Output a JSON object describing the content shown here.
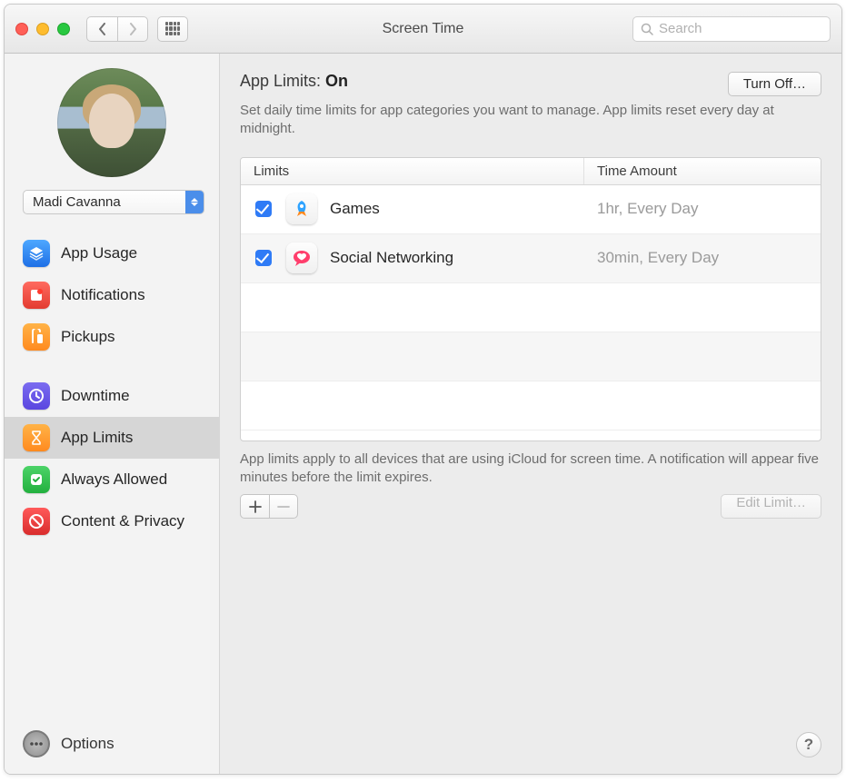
{
  "window": {
    "title": "Screen Time",
    "search_placeholder": "Search"
  },
  "sidebar": {
    "user_name": "Madi Cavanna",
    "groups": [
      [
        {
          "id": "app-usage",
          "label": "App Usage",
          "icon": "layers-icon"
        },
        {
          "id": "notifications",
          "label": "Notifications",
          "icon": "bell-square-icon"
        },
        {
          "id": "pickups",
          "label": "Pickups",
          "icon": "pickup-icon"
        }
      ],
      [
        {
          "id": "downtime",
          "label": "Downtime",
          "icon": "clock-moon-icon"
        },
        {
          "id": "app-limits",
          "label": "App Limits",
          "icon": "hourglass-icon",
          "selected": true
        },
        {
          "id": "always-allowed",
          "label": "Always Allowed",
          "icon": "check-shield-icon"
        },
        {
          "id": "content-privacy",
          "label": "Content & Privacy",
          "icon": "no-entry-icon"
        }
      ]
    ],
    "options_label": "Options"
  },
  "main": {
    "title_prefix": "App Limits: ",
    "status": "On",
    "turn_off_label": "Turn Off…",
    "description": "Set daily time limits for app categories you want to manage. App limits reset every day at midnight.",
    "columns": {
      "limits": "Limits",
      "time": "Time Amount"
    },
    "rows": [
      {
        "enabled": true,
        "icon": "rocket-icon",
        "name": "Games",
        "time": "1hr, Every Day"
      },
      {
        "enabled": true,
        "icon": "heart-bubble-icon",
        "name": "Social Networking",
        "time": "30min, Every Day"
      }
    ],
    "footnote": "App limits apply to all devices that are using iCloud for screen time. A notification will appear five minutes before the limit expires.",
    "add_label": "+",
    "remove_label": "−",
    "edit_label": "Edit Limit…",
    "help_label": "?"
  }
}
